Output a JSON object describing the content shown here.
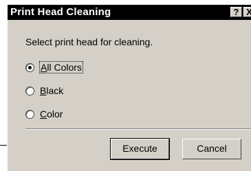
{
  "window": {
    "title": "Print Head Cleaning",
    "help_button": "?",
    "close_button": "X"
  },
  "instruction": "Select print head for cleaning.",
  "options": [
    {
      "prefix": "",
      "mnemonic": "A",
      "rest": "ll Colors",
      "selected": true
    },
    {
      "prefix": "",
      "mnemonic": "B",
      "rest": "lack",
      "selected": false
    },
    {
      "prefix": "",
      "mnemonic": "C",
      "rest": "olor",
      "selected": false
    }
  ],
  "buttons": {
    "execute": "Execute",
    "cancel": "Cancel"
  }
}
